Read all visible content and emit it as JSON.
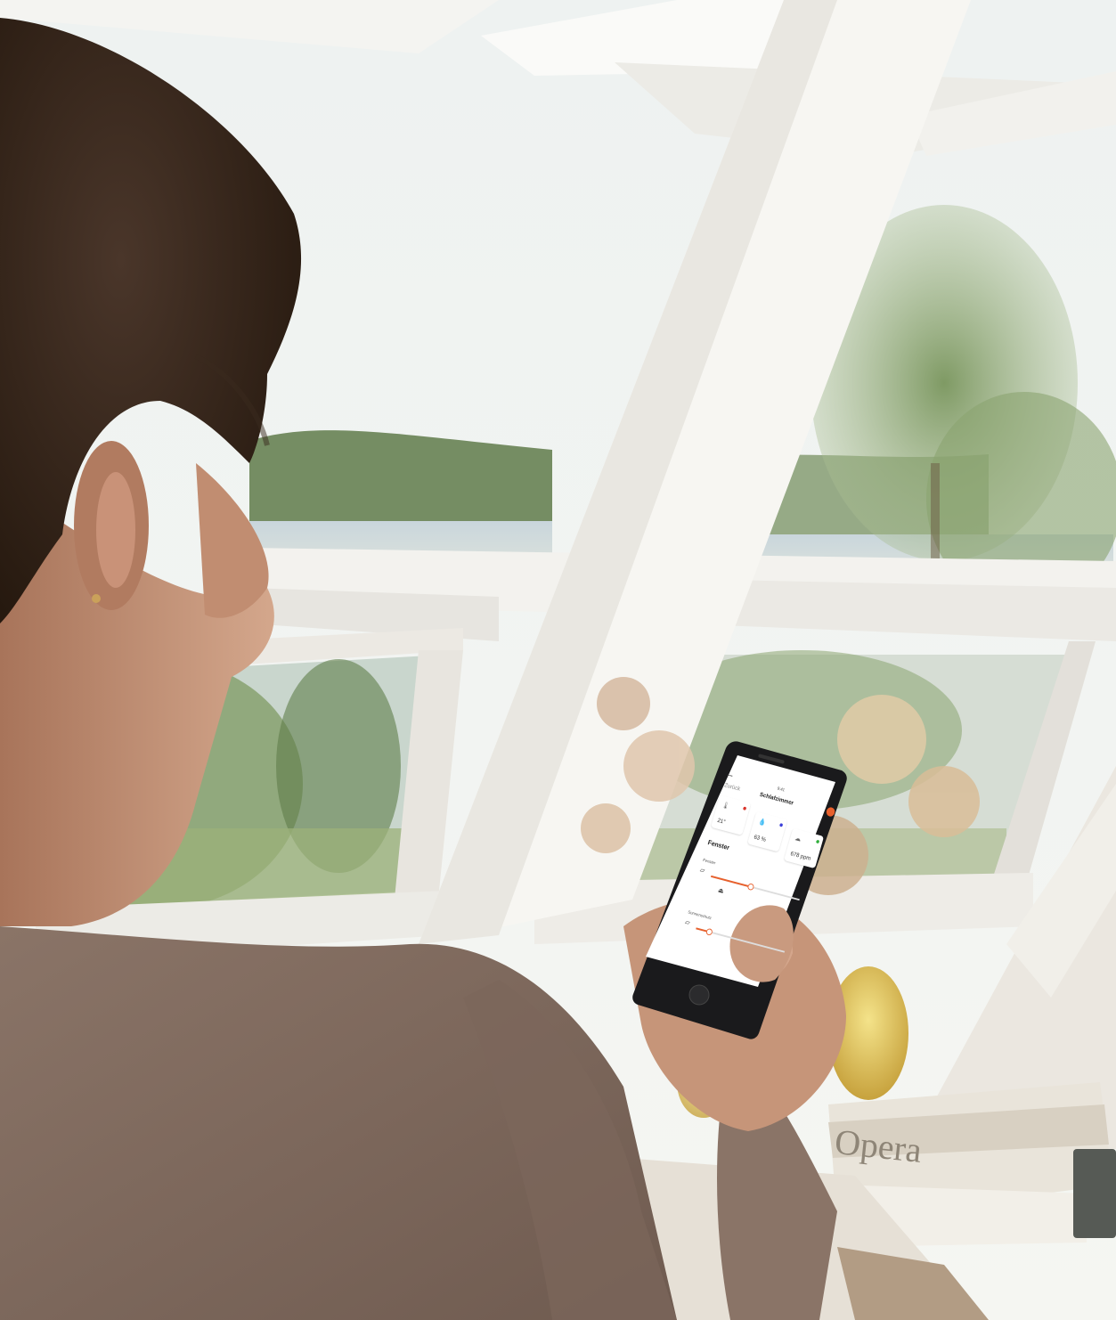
{
  "phone": {
    "status_carrier": "••••",
    "status_time": "9:41",
    "back_label": "Zurück",
    "screen_title": "Schlafzimmer",
    "sensors": [
      {
        "icon": "thermometer-icon",
        "value": "21°",
        "dot_color": "#d9342b"
      },
      {
        "icon": "humidity-icon",
        "value": "63 %",
        "dot_color": "#3b3fd9"
      },
      {
        "icon": "co2-cloud-icon",
        "value": "678 ppm",
        "dot_color": "#2fae3a"
      }
    ],
    "section_title": "Fenster",
    "controls": [
      {
        "label": "Fenster",
        "level": 0.45
      },
      {
        "label": "Sonnenschutz",
        "level": 0.15
      }
    ],
    "accent_color": "#e8602c"
  },
  "scene": {
    "book_title": "Opera"
  }
}
